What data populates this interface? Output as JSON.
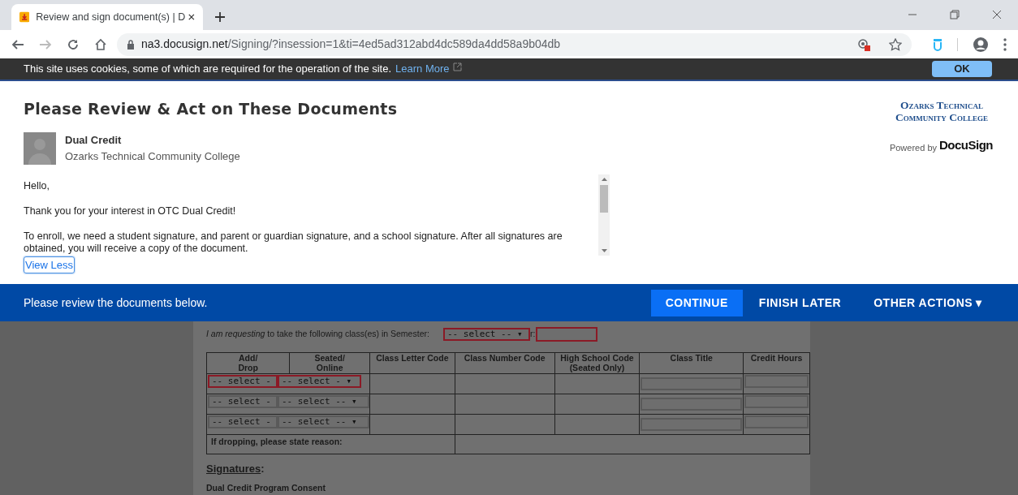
{
  "browser": {
    "tab_title": "Review and sign document(s) | D",
    "url_host": "na3.docusign.net",
    "url_path": "/Signing/?insession=1&ti=4ed5ad312abd4dc589da4dd58a9b04db"
  },
  "cookie_banner": {
    "text": "This site uses cookies, some of which are required for the operation of the site.",
    "link": "Learn More",
    "button": "OK"
  },
  "header": {
    "title": "Please Review & Act on These Documents",
    "sender_name": "Dual Credit",
    "sender_org": "Ozarks Technical Community College",
    "logo_line1": "Ozarks Technical",
    "logo_line2": "Community College",
    "powered_by": "Powered by",
    "powered_brand": "DocuSign"
  },
  "message": {
    "paragraphs": [
      "Hello,",
      "Thank you for your interest in OTC Dual Credit!",
      "To enroll, we need a student signature, and parent or guardian signature, and a school signature. After all signatures are obtained, you will receive a copy of the document."
    ],
    "toggle": "View Less"
  },
  "action_bar": {
    "text": "Please review the documents below.",
    "buttons": [
      {
        "label": "CONTINUE",
        "kind": "primary"
      },
      {
        "label": "FINISH LATER",
        "kind": "text"
      },
      {
        "label": "OTHER ACTIONS ▾",
        "kind": "text"
      }
    ]
  },
  "document": {
    "request_line": "*I am requesting* to take the following class(es) in Semester:",
    "semester_select": {
      "value": "-- select -- ▾",
      "required": true
    },
    "year_label": "r:",
    "year_field": {
      "required": true
    },
    "columns": [
      "Add/\nDrop",
      "Seated/\nOnline",
      "Class Letter Code",
      "Class Number Code",
      "High School Code\n(Seated Only)",
      "Class Title",
      "Credit Hours"
    ],
    "rows": [
      {
        "add_drop": {
          "value": "-- select -",
          "required": true
        },
        "seated": {
          "value": "-- select - ▾",
          "required": true
        }
      },
      {
        "add_drop": {
          "value": "-- select -",
          "required": false
        },
        "seated": {
          "value": "-- select -- ▾",
          "required": false
        }
      },
      {
        "add_drop": {
          "value": "-- select -",
          "required": false
        },
        "seated": {
          "value": "-- select -- ▾",
          "required": false
        }
      }
    ],
    "drop_reason_label": "If dropping, please state reason:",
    "section_heading": "Signatures",
    "section_heading_suffix": ":",
    "subheading": "Dual Credit Program Consent"
  }
}
